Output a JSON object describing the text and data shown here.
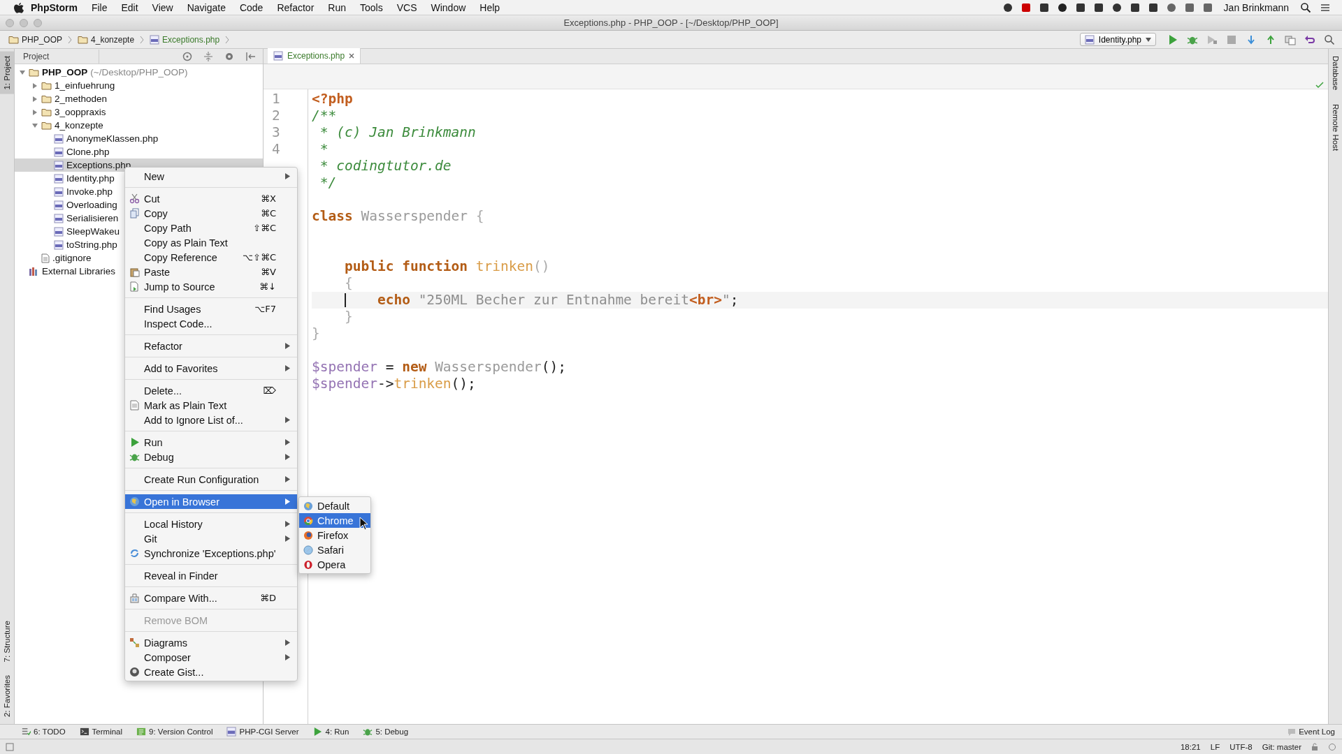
{
  "mac_menu_bar": {
    "app": "PhpStorm",
    "menus": [
      "File",
      "Edit",
      "View",
      "Navigate",
      "Code",
      "Refactor",
      "Run",
      "Tools",
      "VCS",
      "Window",
      "Help"
    ],
    "user": "Jan Brinkmann"
  },
  "window": {
    "title": "Exceptions.php - PHP_OOP - [~/Desktop/PHP_OOP]"
  },
  "breadcrumbs": [
    "PHP_OOP",
    "4_konzepte",
    "Exceptions.php"
  ],
  "run_config": "Identity.php",
  "left_strip": [
    {
      "label": "1: Project",
      "selected": true
    },
    {
      "label": "7: Structure",
      "selected": false
    },
    {
      "label": "2: Favorites",
      "selected": false
    }
  ],
  "right_strip": [
    "Database",
    "Remote Host"
  ],
  "project_panel": {
    "view": "Project",
    "tree": [
      {
        "name": "PHP_OOP",
        "path": "(~/Desktop/PHP_OOP)",
        "kind": "folder",
        "expanded": true,
        "selected": false,
        "children": [
          {
            "name": "1_einfuehrung",
            "kind": "folder",
            "expanded": false,
            "selected": false
          },
          {
            "name": "2_methoden",
            "kind": "folder",
            "expanded": false,
            "selected": false
          },
          {
            "name": "3_ooppraxis",
            "kind": "folder",
            "expanded": false,
            "selected": false
          },
          {
            "name": "4_konzepte",
            "kind": "folder",
            "expanded": true,
            "selected": false,
            "children": [
              {
                "name": "AnonymeKlassen.php",
                "kind": "php",
                "selected": false
              },
              {
                "name": "Clone.php",
                "kind": "php",
                "selected": false
              },
              {
                "name": "Exceptions.php",
                "kind": "php",
                "selected": true
              },
              {
                "name": "Identity.php",
                "kind": "php",
                "selected": false
              },
              {
                "name": "Invoke.php",
                "kind": "php",
                "selected": false
              },
              {
                "name": "Overloading",
                "kind": "php",
                "selected": false
              },
              {
                "name": "Serialisieren",
                "kind": "php",
                "selected": false
              },
              {
                "name": "SleepWakeu",
                "kind": "php",
                "selected": false
              },
              {
                "name": "toString.php",
                "kind": "php",
                "selected": false
              }
            ]
          },
          {
            "name": ".gitignore",
            "kind": "text",
            "selected": false
          }
        ]
      },
      {
        "name": "External Libraries",
        "kind": "library",
        "selected": false
      }
    ]
  },
  "editor": {
    "tabs": [
      {
        "label": "Exceptions.php",
        "selected": true
      }
    ],
    "line_numbers": [
      "1",
      "2",
      "3",
      "4"
    ],
    "lines": [
      {
        "kind": "top",
        "tokens": [
          {
            "t": "<?php",
            "kind": "tag"
          }
        ]
      },
      {
        "kind": "top",
        "tokens": [
          {
            "t": "/**",
            "kind": "comment"
          }
        ]
      },
      {
        "kind": "top",
        "tokens": [
          {
            "t": " * (c) Jan Brinkmann",
            "kind": "comment"
          }
        ]
      },
      {
        "kind": "top",
        "tokens": [
          {
            "t": " *",
            "kind": "comment"
          }
        ]
      },
      {
        "kind": "top",
        "tokens": [
          {
            "t": " * codingtutor.de",
            "kind": "comment"
          }
        ]
      },
      {
        "kind": "top",
        "tokens": [
          {
            "t": " */",
            "kind": "comment"
          }
        ]
      },
      {
        "kind": "blank"
      },
      {
        "kind": "top",
        "tokens": [
          {
            "t": "class ",
            "kind": "keyword"
          },
          {
            "t": "Wasserspender",
            "kind": "class"
          },
          {
            "t": " {",
            "kind": "punct"
          }
        ]
      },
      {
        "kind": "blank"
      },
      {
        "kind": "blank"
      },
      {
        "kind": "member",
        "tokens": [
          {
            "t": "public function ",
            "kind": "keyword"
          },
          {
            "t": "trinken",
            "kind": "function"
          },
          {
            "t": "()",
            "kind": "punct"
          }
        ]
      },
      {
        "kind": "member",
        "tokens": [
          {
            "t": "{",
            "kind": "punct"
          }
        ]
      },
      {
        "kind": "body",
        "current": true,
        "tokens": [
          {
            "t": "echo ",
            "kind": "keyword"
          },
          {
            "t": "\"250ML Becher zur Entnahme bereit",
            "kind": "string"
          },
          {
            "t": "<br>",
            "kind": "tag"
          },
          {
            "t": "\"",
            "kind": "string"
          },
          {
            "t": ";",
            "kind": "plain"
          }
        ]
      },
      {
        "kind": "member",
        "tokens": [
          {
            "t": "}",
            "kind": "punct"
          }
        ]
      },
      {
        "kind": "top",
        "tokens": [
          {
            "t": "}",
            "kind": "punct"
          }
        ]
      },
      {
        "kind": "blank"
      },
      {
        "kind": "top",
        "tokens": [
          {
            "t": "$spender",
            "kind": "variable"
          },
          {
            "t": " = ",
            "kind": "plain"
          },
          {
            "t": "new ",
            "kind": "keyword"
          },
          {
            "t": "Wasserspender",
            "kind": "class"
          },
          {
            "t": "();",
            "kind": "plain"
          }
        ]
      },
      {
        "kind": "top",
        "tokens": [
          {
            "t": "$spender",
            "kind": "variable"
          },
          {
            "t": "->",
            "kind": "plain"
          },
          {
            "t": "trinken",
            "kind": "function"
          },
          {
            "t": "();",
            "kind": "plain"
          }
        ]
      }
    ]
  },
  "context_menu": {
    "groups": [
      [
        {
          "label": "New",
          "submenu": true
        }
      ],
      [
        {
          "label": "Cut",
          "shortcut": "⌘X",
          "kind": "cut"
        },
        {
          "label": "Copy",
          "shortcut": "⌘C",
          "kind": "copy"
        },
        {
          "label": "Copy Path",
          "shortcut": "⇧⌘C"
        },
        {
          "label": "Copy as Plain Text"
        },
        {
          "label": "Copy Reference",
          "shortcut": "⌥⇧⌘C"
        },
        {
          "label": "Paste",
          "shortcut": "⌘V",
          "kind": "paste"
        },
        {
          "label": "Jump to Source",
          "shortcut": "⌘↓",
          "kind": "jump"
        }
      ],
      [
        {
          "label": "Find Usages",
          "shortcut": "⌥F7"
        },
        {
          "label": "Inspect Code..."
        }
      ],
      [
        {
          "label": "Refactor",
          "submenu": true
        }
      ],
      [
        {
          "label": "Add to Favorites",
          "submenu": true
        }
      ],
      [
        {
          "label": "Delete...",
          "shortcut": "⌦"
        },
        {
          "label": "Mark as Plain Text",
          "kind": "document"
        },
        {
          "label": "Add to Ignore List of...",
          "submenu": true
        }
      ],
      [
        {
          "label": "Run",
          "submenu": true,
          "kind": "run"
        },
        {
          "label": "Debug",
          "submenu": true,
          "kind": "debug"
        }
      ],
      [
        {
          "label": "Create Run Configuration",
          "submenu": true
        }
      ],
      [
        {
          "label": "Open in Browser",
          "submenu": true,
          "kind": "globe",
          "selected": true
        }
      ],
      [
        {
          "label": "Local History",
          "submenu": true
        },
        {
          "label": "Git",
          "submenu": true
        },
        {
          "label": "Synchronize 'Exceptions.php'",
          "kind": "sync"
        }
      ],
      [
        {
          "label": "Reveal in Finder"
        }
      ],
      [
        {
          "label": "Compare With...",
          "shortcut": "⌘D",
          "kind": "compare"
        }
      ],
      [
        {
          "label": "Remove BOM",
          "disabled": true
        }
      ],
      [
        {
          "label": "Diagrams",
          "submenu": true,
          "kind": "diagram"
        },
        {
          "label": "Composer",
          "submenu": true
        },
        {
          "label": "Create Gist...",
          "kind": "gist"
        }
      ]
    ]
  },
  "browser_submenu": [
    {
      "label": "Default",
      "kind": "globe",
      "selected": false
    },
    {
      "label": "Chrome",
      "kind": "chrome",
      "selected": true
    },
    {
      "label": "Firefox",
      "kind": "firefox",
      "selected": false
    },
    {
      "label": "Safari",
      "kind": "safari",
      "selected": false
    },
    {
      "label": "Opera",
      "kind": "opera",
      "selected": false
    }
  ],
  "tool_windows": [
    {
      "label": "6: TODO",
      "kind": "todo"
    },
    {
      "label": "Terminal",
      "kind": "terminal"
    },
    {
      "label": "9: Version Control",
      "kind": "vcs"
    },
    {
      "label": "PHP-CGI Server",
      "kind": "php"
    },
    {
      "label": "4: Run",
      "kind": "run"
    },
    {
      "label": "5: Debug",
      "kind": "debug"
    }
  ],
  "event_log": "Event Log",
  "status_bar": {
    "position": "18:21",
    "line_separator": "LF",
    "encoding": "UTF-8",
    "branch": "Git: master"
  }
}
